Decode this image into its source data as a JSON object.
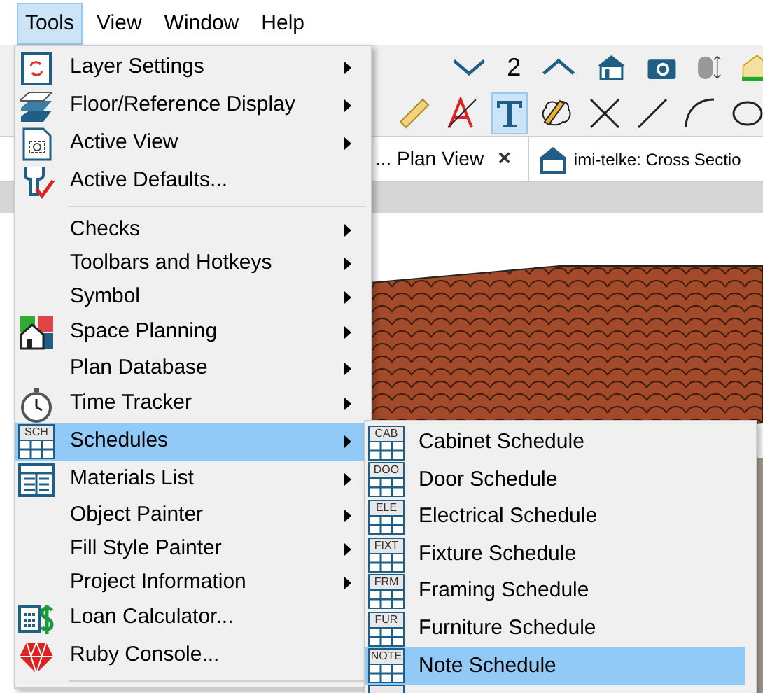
{
  "menubar": [
    {
      "label": "Tools",
      "selected": true
    },
    {
      "label": "View",
      "selected": false
    },
    {
      "label": "Window",
      "selected": false
    },
    {
      "label": "Help",
      "selected": false
    }
  ],
  "toolbar": {
    "floor_number": "2",
    "tools": [
      {
        "selected": false
      },
      {
        "selected": false
      },
      {
        "selected": true
      },
      {
        "selected": false
      },
      {
        "selected": false
      },
      {
        "selected": false
      },
      {
        "selected": false
      },
      {
        "selected": false
      }
    ]
  },
  "tabs": [
    {
      "label": "... Plan View",
      "close": "×"
    },
    {
      "label": "imi-telke: Cross Sectio"
    }
  ],
  "menu": {
    "items": [
      {
        "kind": "item",
        "label": "Layer Settings",
        "submenu": true,
        "selected": false
      },
      {
        "kind": "item",
        "label": "Floor/Reference Display",
        "submenu": true,
        "selected": false
      },
      {
        "kind": "item",
        "label": "Active View",
        "submenu": true,
        "selected": false
      },
      {
        "kind": "item",
        "label": "Active Defaults...",
        "submenu": false,
        "selected": false
      },
      {
        "kind": "separator"
      },
      {
        "kind": "item",
        "label": "Checks",
        "submenu": true,
        "selected": false
      },
      {
        "kind": "item",
        "label": "Toolbars and Hotkeys",
        "submenu": true,
        "selected": false
      },
      {
        "kind": "item",
        "label": "Symbol",
        "submenu": true,
        "selected": false
      },
      {
        "kind": "item",
        "label": "Space Planning",
        "submenu": true,
        "selected": false
      },
      {
        "kind": "item",
        "label": "Plan Database",
        "submenu": true,
        "selected": false
      },
      {
        "kind": "item",
        "label": "Time Tracker",
        "submenu": true,
        "selected": false
      },
      {
        "kind": "item",
        "label": "Schedules",
        "icon_text": "SCH",
        "submenu": true,
        "selected": true
      },
      {
        "kind": "item",
        "label": "Materials List",
        "submenu": true,
        "selected": false
      },
      {
        "kind": "item",
        "label": "Object Painter",
        "submenu": true,
        "selected": false
      },
      {
        "kind": "item",
        "label": "Fill Style Painter",
        "submenu": true,
        "selected": false
      },
      {
        "kind": "item",
        "label": "Project Information",
        "submenu": true,
        "selected": false
      },
      {
        "kind": "item",
        "label": "Loan Calculator...",
        "submenu": false,
        "selected": false
      },
      {
        "kind": "item",
        "label": "Ruby Console...",
        "submenu": false,
        "selected": false
      },
      {
        "kind": "separator"
      }
    ]
  },
  "submenu": {
    "items": [
      {
        "label": "Cabinet Schedule",
        "icon_text": "CAB",
        "selected": false
      },
      {
        "label": "Door Schedule",
        "icon_text": "DOO",
        "selected": false
      },
      {
        "label": "Electrical Schedule",
        "icon_text": "ELE",
        "selected": false
      },
      {
        "label": "Fixture Schedule",
        "icon_text": "FIXT",
        "selected": false
      },
      {
        "label": "Framing Schedule",
        "icon_text": "FRM",
        "selected": false
      },
      {
        "label": "Furniture Schedule",
        "icon_text": "FUR",
        "selected": false
      },
      {
        "label": "Note Schedule",
        "icon_text": "NOTE",
        "selected": true
      }
    ]
  }
}
